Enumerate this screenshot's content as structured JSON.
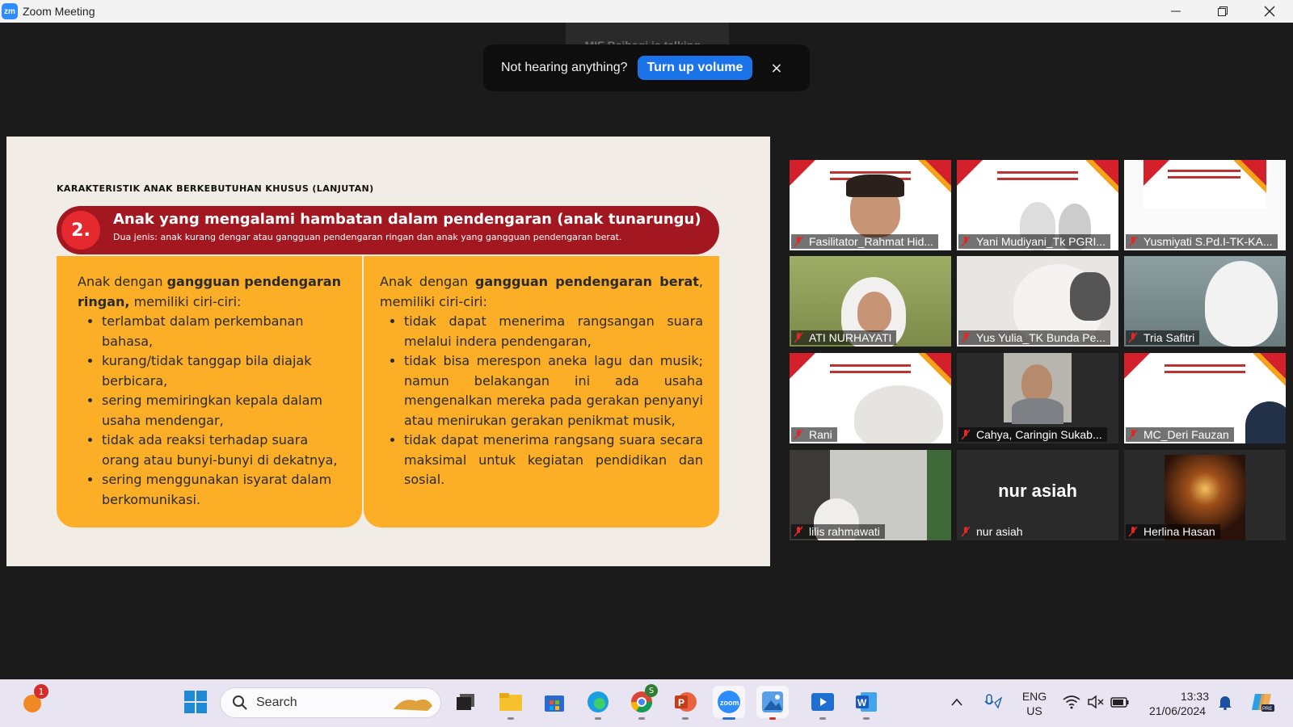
{
  "window": {
    "title": "Zoom Meeting",
    "logo_text": "zm"
  },
  "meeting": {
    "talking_indicator": "MIF Baihaqi is talking...",
    "volume_toast": {
      "message": "Not hearing anything?",
      "button": "Turn up volume",
      "close": "×"
    }
  },
  "slide": {
    "heading": "KARAKTERISTIK ANAK BERKEBUTUHAN KHUSUS (LANJUTAN)",
    "number": "2.",
    "title": "Anak yang mengalami hambatan dalam pendengaran (anak tunarungu)",
    "subtitle": "Dua jenis: anak kurang dengar atau gangguan pendengaran ringan dan anak yang gangguan pendengaran berat.",
    "left": {
      "intro_pre": "Anak dengan ",
      "intro_bold": "gangguan pendengaran ringan,",
      "intro_post": " memiliki ciri-ciri:",
      "items": [
        "terlambat dalam perkembanan bahasa,",
        "kurang/tidak tanggap bila diajak berbicara,",
        "sering memiringkan kepala dalam usaha mendengar,",
        "tidak ada reaksi terhadap suara orang atau bunyi-bunyi di dekatnya,",
        "sering menggunakan isyarat dalam berkomunikasi."
      ]
    },
    "right": {
      "intro_pre": "Anak dengan ",
      "intro_bold": "gangguan pendengaran berat",
      "intro_post": ", memiliki ciri-ciri:",
      "items": [
        "tidak dapat menerima rangsangan suara melalui indera pendengaran,",
        "tidak bisa merespon aneka lagu dan musik; namun belakangan ini ada usaha mengenalkan mereka pada gerakan penyanyi atau menirukan gerakan penikmat musik,",
        "tidak dapat menerima rangsang suara secara maksimal untuk kegiatan pendidikan dan sosial."
      ]
    }
  },
  "participants": [
    {
      "name": "Fasilitator_Rahmat Hid..."
    },
    {
      "name": "Yani Mudiyani_Tk PGRI..."
    },
    {
      "name": "Yusmiyati S.Pd.I-TK-KA..."
    },
    {
      "name": "ATI NURHAYATI"
    },
    {
      "name": "Yus Yulia_TK Bunda Pe..."
    },
    {
      "name": "Tria Safitri"
    },
    {
      "name": "Rani"
    },
    {
      "name": "Cahya, Caringin Sukab..."
    },
    {
      "name": "MC_Deri Fauzan"
    },
    {
      "name": "lilis rahmawati"
    },
    {
      "name": "nur asiah",
      "display_text": "nur asiah"
    },
    {
      "name": "Herlina Hasan"
    }
  ],
  "taskbar": {
    "search_placeholder": "Search",
    "notification_badge": "1",
    "chrome_badge": "S",
    "language": "ENG",
    "region": "US",
    "time": "13:33",
    "date": "21/06/2024"
  },
  "colors": {
    "accent": "#2d8cff",
    "slide_red": "#a31720",
    "slide_orange": "#fcae27",
    "toast_button": "#1a73e8"
  }
}
